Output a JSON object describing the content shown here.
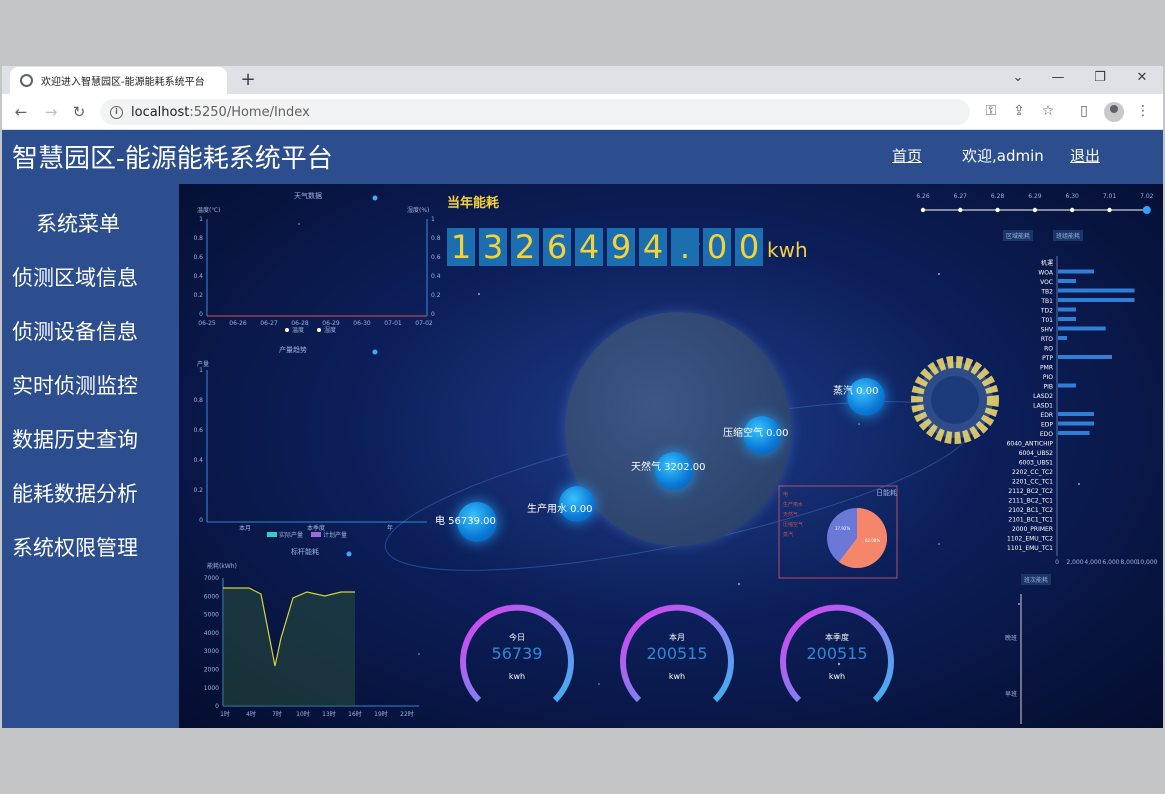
{
  "browser": {
    "tab_title": "欢迎进入智慧园区-能源能耗系统平台",
    "url_host": "localhost",
    "url_rest": ":5250/Home/Index"
  },
  "header": {
    "title": "智慧园区-能源能耗系统平台",
    "home_link": "首页",
    "welcome": "欢迎,admin",
    "logout": "退出"
  },
  "sidebar": {
    "title": "系统菜单",
    "items": [
      {
        "label": "侦测区域信息"
      },
      {
        "label": "侦测设备信息"
      },
      {
        "label": "实时侦测监控"
      },
      {
        "label": "数据历史查询"
      },
      {
        "label": "能耗数据分析"
      },
      {
        "label": "系统权限管理"
      }
    ]
  },
  "dashboard": {
    "annual_label": "当年能耗",
    "annual_digits": [
      "1",
      "3",
      "2",
      "6",
      "4",
      "9",
      "4",
      ".",
      "0",
      "0"
    ],
    "annual_unit": "kwh",
    "weather": {
      "title": "天气数据",
      "y_left": "温度(℃)",
      "y_right": "湿度(%)",
      "y_ticks": [
        "1",
        "0.8",
        "0.6",
        "0.4",
        "0.2",
        "0"
      ],
      "x_ticks": [
        "06-25",
        "06-26",
        "06-27",
        "06-28",
        "06-29",
        "06-30",
        "07-01",
        "07-02"
      ],
      "legend": [
        "温度",
        "湿度"
      ]
    },
    "production": {
      "title": "产量趋势",
      "ylabel": "产量",
      "y_ticks": [
        "1",
        "0.8",
        "0.6",
        "0.4",
        "0.2",
        "0"
      ],
      "x_ticks": [
        "本月",
        "本季度",
        "年"
      ],
      "legend": [
        "实际产量",
        "计划产量"
      ]
    },
    "benchmark": {
      "title": "标杆能耗",
      "ylabel": "能耗(kWh)",
      "y_ticks": [
        "7000",
        "6000",
        "5000",
        "4000",
        "3000",
        "2000",
        "1000",
        "0"
      ],
      "x_ticks": [
        "1时",
        "4时",
        "7时",
        "10时",
        "13时",
        "16时",
        "19时",
        "22时"
      ]
    },
    "energy_balls": [
      {
        "label": "电 56739.00"
      },
      {
        "label": "生产用水 0.00"
      },
      {
        "label": "天然气 3202.00"
      },
      {
        "label": "压缩空气 0.00"
      },
      {
        "label": "蒸汽 0.00"
      }
    ],
    "gauges": [
      {
        "label": "今日",
        "value": "56739",
        "unit": "kwh"
      },
      {
        "label": "本月",
        "value": "200515",
        "unit": "kwh"
      },
      {
        "label": "本季度",
        "value": "200515",
        "unit": "kwh"
      }
    ],
    "day_pie": {
      "title": "日能耗",
      "legend": [
        "电",
        "生产用水",
        "天然气",
        "压缩空气",
        "蒸汽"
      ],
      "slices_pct": [
        {
          "label": "37.92%",
          "value": 37.92
        },
        {
          "label": "62.08%",
          "value": 62.08
        }
      ]
    },
    "timeline": [
      "6.26",
      "6.27",
      "6.28",
      "6.29",
      "6.30",
      "7.01",
      "7.02"
    ],
    "region_tabs": [
      "区域能耗",
      "班组能耗"
    ],
    "region_bars": {
      "categories": [
        "机運",
        "WOA",
        "VOC",
        "TB2",
        "TB1",
        "TD2",
        "T01",
        "SHV",
        "RTO",
        "RO",
        "PTP",
        "PMR",
        "PIO",
        "PIB",
        "LASD2",
        "LASD1",
        "EDR",
        "EDP",
        "EDO",
        "6040_ANTICHIP",
        "6004_UBS2",
        "6003_UBS1",
        "2202_CC_TC2",
        "2201_CC_TC1",
        "2112_BC2_TC2",
        "2111_BC2_TC1",
        "2102_BC1_TC2",
        "2101_BC1_TC1",
        "2000_PRIMER",
        "1102_EMU_TC2",
        "1101_EMU_TC1"
      ],
      "values": [
        0,
        4000,
        2000,
        8500,
        8500,
        2000,
        2000,
        5300,
        1000,
        0,
        6000,
        0,
        0,
        2000,
        0,
        0,
        4000,
        4000,
        3500,
        0,
        0,
        0,
        0,
        0,
        0,
        0,
        0,
        0,
        0,
        0,
        0
      ],
      "x_ticks": [
        "0",
        "2,000",
        "4,000",
        "6,000",
        "8,000",
        "10,000"
      ]
    },
    "shift_title": "班次能耗",
    "shift_rows": [
      "晚班",
      "早班"
    ]
  }
}
